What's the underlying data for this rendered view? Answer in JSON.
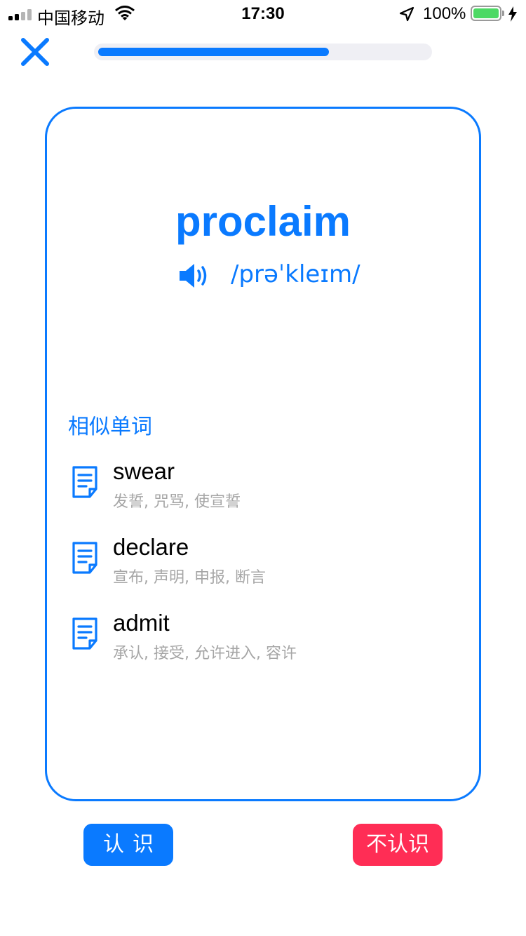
{
  "status_bar": {
    "carrier": "中国移动",
    "time": "17:30",
    "battery_percent": "100%",
    "battery_level": 1.0,
    "battery_color": "#4cd964"
  },
  "nav": {
    "close_icon": "close-icon",
    "progress": 0.7
  },
  "card": {
    "word": "proclaim",
    "phonetic": "/prəˈkleɪm/",
    "speaker_icon": "speaker-icon",
    "similar_title": "相似单词",
    "similar_words": [
      {
        "word": "swear",
        "meaning": "发誓, 咒骂, 使宣誓"
      },
      {
        "word": "declare",
        "meaning": "宣布, 声明, 申报, 断言"
      },
      {
        "word": "admit",
        "meaning": "承认, 接受, 允许进入, 容许"
      }
    ]
  },
  "buttons": {
    "know_label": "认识",
    "unknown_label": "不认识"
  },
  "colors": {
    "accent": "#0a7aff",
    "danger": "#ff2d55",
    "secondary_text": "#a6a6a6"
  }
}
